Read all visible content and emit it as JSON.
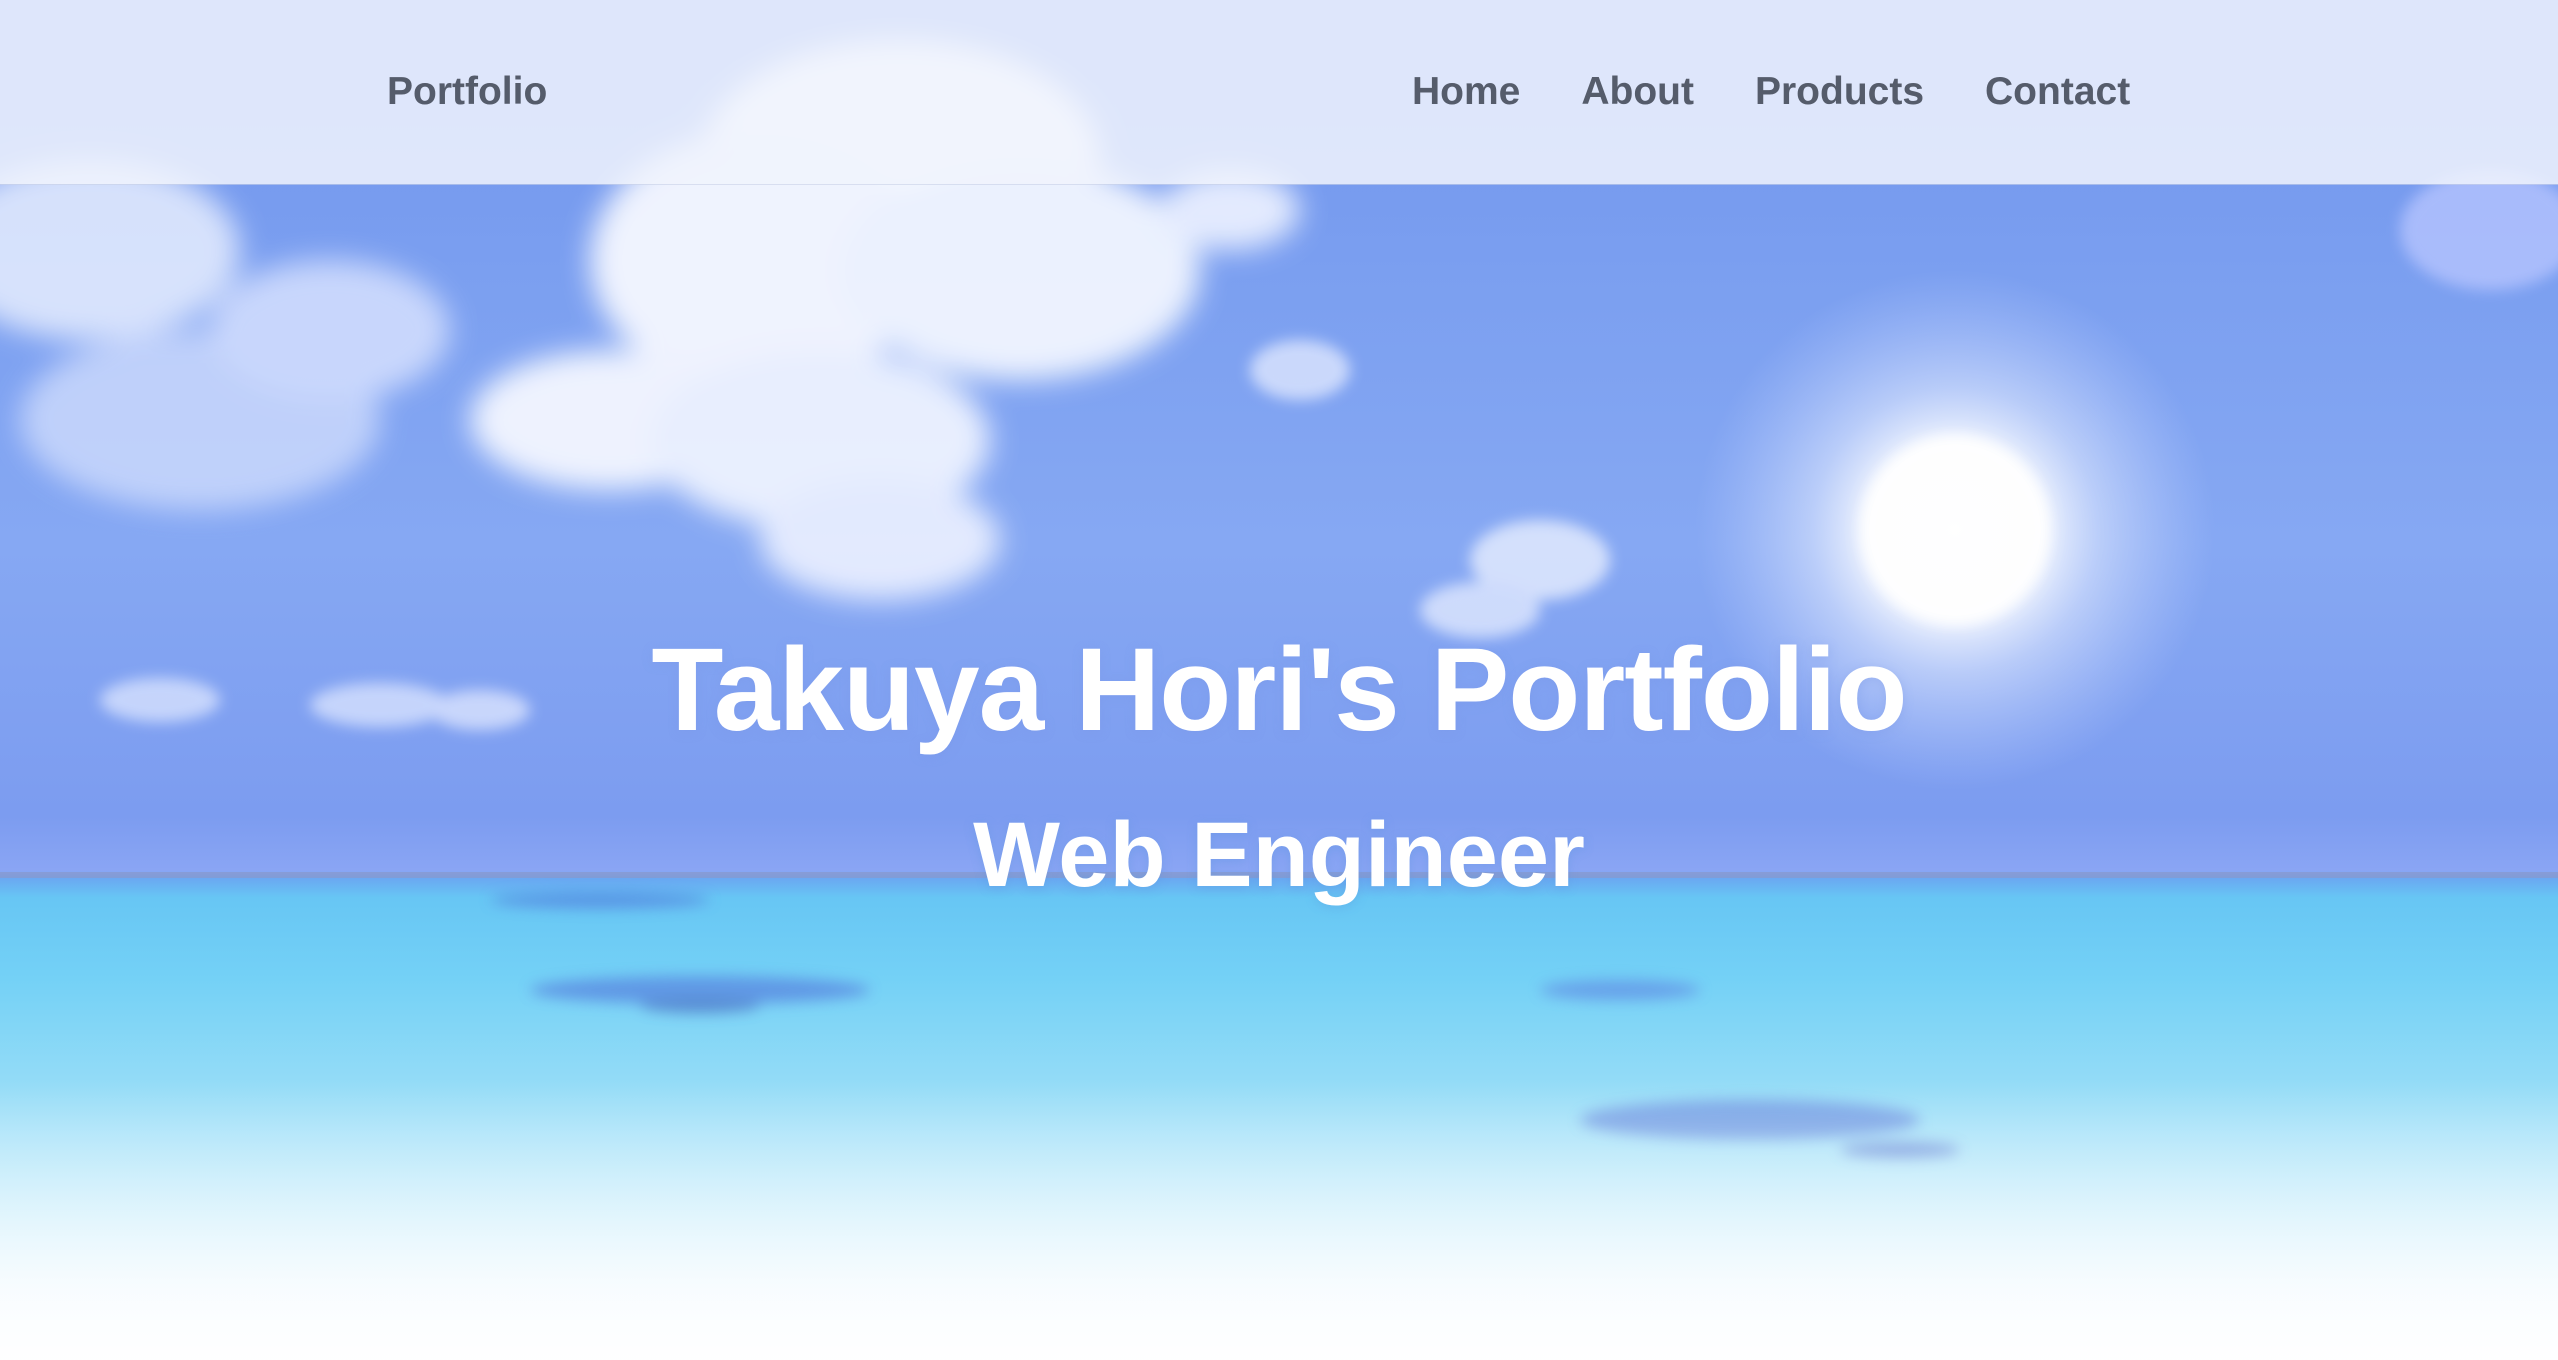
{
  "nav": {
    "brand": "Portfolio",
    "links": [
      "Home",
      "About",
      "Products",
      "Contact"
    ]
  },
  "hero": {
    "title": "Takuya Hori's Portfolio",
    "subtitle": "Web Engineer",
    "background": "beach-sky-sea-image"
  },
  "colors": {
    "nav_text": "#555c6b",
    "hero_text": "#ffffff",
    "sky": "#7b9ff0",
    "sea": "#74d1f6"
  }
}
